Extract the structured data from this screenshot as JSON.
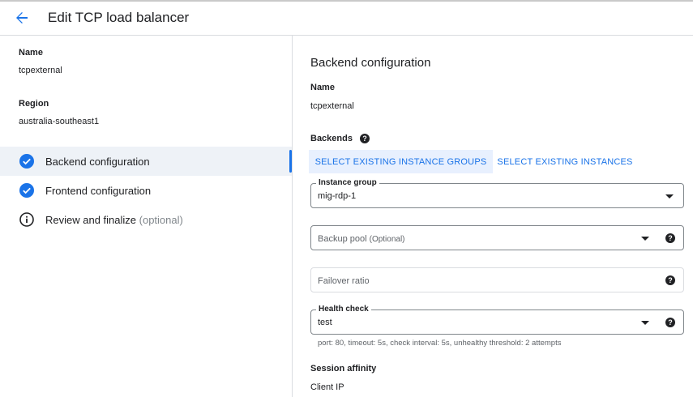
{
  "header": {
    "title": "Edit TCP load balancer",
    "back_icon": "arrow-left-icon"
  },
  "summary": {
    "name_label": "Name",
    "name_value": "tcpexternal",
    "region_label": "Region",
    "region_value": "australia-southeast1"
  },
  "steps": [
    {
      "label": "Backend configuration",
      "suffix": "",
      "icon": "check-circle-icon",
      "active": true
    },
    {
      "label": "Frontend configuration",
      "suffix": "",
      "icon": "check-circle-icon",
      "active": false
    },
    {
      "label": "Review and finalize",
      "suffix": "(optional)",
      "icon": "info-icon",
      "active": false
    }
  ],
  "backend": {
    "title": "Backend configuration",
    "name_label": "Name",
    "name_value": "tcpexternal",
    "backends_label": "Backends",
    "tabs": [
      {
        "label": "SELECT EXISTING INSTANCE GROUPS",
        "selected": true
      },
      {
        "label": "SELECT EXISTING INSTANCES",
        "selected": false
      }
    ],
    "instance_group": {
      "label": "Instance group",
      "value": "mig-rdp-1"
    },
    "backup_pool": {
      "placeholder": "Backup pool",
      "optional": "(Optional)"
    },
    "failover_ratio": {
      "placeholder": "Failover ratio"
    },
    "health_check": {
      "label": "Health check",
      "value": "test",
      "hint": "port: 80, timeout: 5s, check interval: 5s, unhealthy threshold: 2 attempts"
    },
    "session_affinity_label": "Session affinity",
    "session_affinity_value": "Client IP",
    "help_glyph": "?"
  },
  "colors": {
    "accent": "#1a73e8",
    "active_step_bg": "#eef2f7",
    "selected_tab_bg": "#e8f0fe",
    "border": "#dadce0"
  }
}
